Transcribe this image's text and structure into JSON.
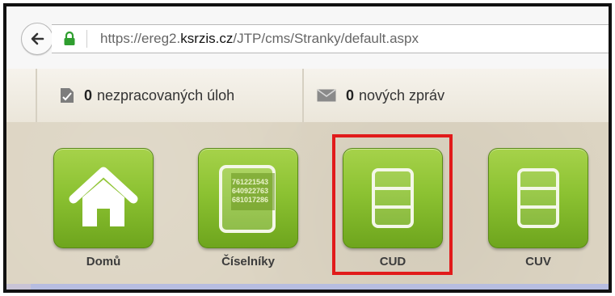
{
  "browser": {
    "url_prefix": "https://ereg2.",
    "url_domain": "ksrzis.cz",
    "url_path": "/JTP/cms/Stranky/default.aspx"
  },
  "status": {
    "tasks_count": "0",
    "tasks_label": "nezpracovaných úloh",
    "messages_count": "0",
    "messages_label": "nových zpráv"
  },
  "tiles": [
    {
      "label": "Domů",
      "icon": "home-icon"
    },
    {
      "label": "Číselníky",
      "icon": "codebook-icon",
      "numbers": [
        "761221543",
        "640922763",
        "681017286"
      ]
    },
    {
      "label": "CUD",
      "icon": "register-icon"
    },
    {
      "label": "CUV",
      "icon": "register-icon"
    }
  ],
  "colors": {
    "tile_green": "#8cc232",
    "highlight_red": "#e11b1b"
  }
}
